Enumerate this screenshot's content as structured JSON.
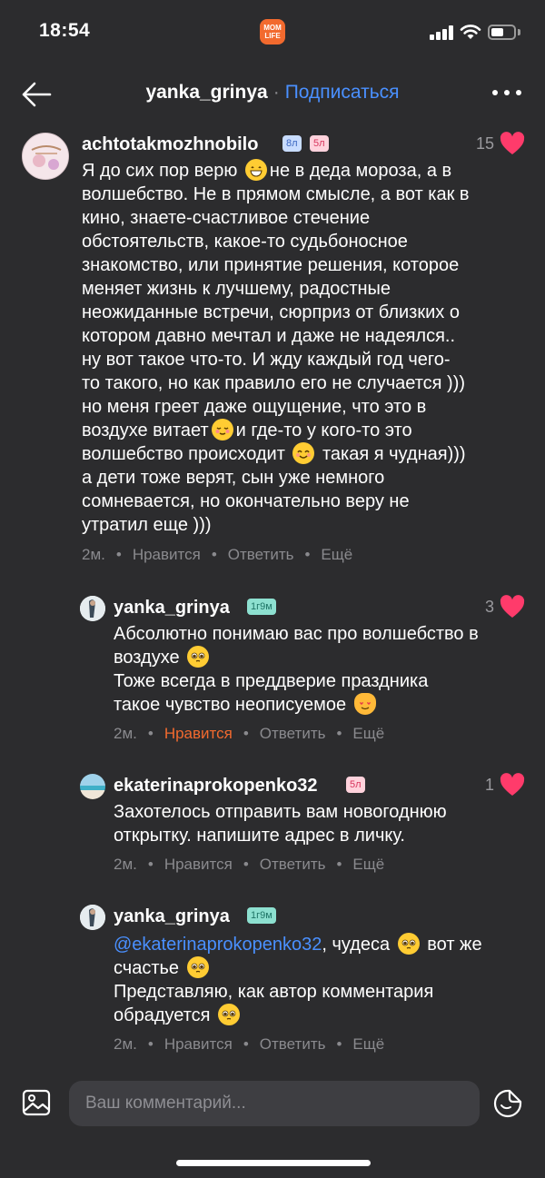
{
  "status_bar": {
    "time": "18:54",
    "app_badge": "MOM LIFE"
  },
  "header": {
    "title": "yanka_grinya",
    "separator": "·",
    "follow_label": "Подписаться"
  },
  "colors": {
    "background": "#2c2c2e",
    "accent_blue": "#4a90ff",
    "heart_pink": "#ff3b6b",
    "liked_orange": "#f26a2e",
    "muted": "#8a8a8e"
  },
  "comments": [
    {
      "username": "achtotakmozhnobilo",
      "badges": [
        "8л",
        "5л"
      ],
      "likes": "15",
      "lines": [
        [
          "Я до сих пор верю ",
          "grin-emoji",
          "не в деда мороза, а в"
        ],
        [
          "волшебство. Не в прямом смысле, а вот как в"
        ],
        [
          "кино, знаете-счастливое стечение"
        ],
        [
          "обстоятельств, какое-то судьбоносное"
        ],
        [
          "знакомство, или принятие решения, которое"
        ],
        [
          "меняет жизнь к лучшему, радостные"
        ],
        [
          "неожиданные встречи, сюрприз от близких о"
        ],
        [
          "котором давно мечтал и даже не надеялся.."
        ],
        [
          "ну вот такое что-то. И жду каждый год чего-"
        ],
        [
          "то такого, но как правило его не случается )))"
        ],
        [
          "но меня греет даже ощущение, что это в"
        ],
        [
          "воздухе витает",
          "blush-emoji",
          "и где-то у кого-то это"
        ],
        [
          "волшебство происходит ",
          "smile-emoji",
          " такая я чудная)))"
        ],
        [
          "а дети тоже верят, сын уже немного"
        ],
        [
          "сомневается, но окончательно веру не"
        ],
        [
          "утратил еще )))"
        ]
      ],
      "time": "2м.",
      "like_label": "Нравится",
      "reply_label": "Ответить",
      "more_label": "Ещё"
    },
    {
      "username": "yanka_grinya",
      "badges": [
        "1г9м"
      ],
      "likes": "3",
      "lines": [
        [
          "Абсолютно понимаю вас про волшебство в"
        ],
        [
          "воздухе ",
          "pleading-emoji"
        ],
        [
          "Тоже всегда в преддверие праздника"
        ],
        [
          "такое чувство неописуемое ",
          "heart-eyes-cat-emoji"
        ]
      ],
      "time": "2м.",
      "like_label": "Нравится",
      "reply_label": "Ответить",
      "more_label": "Ещё"
    },
    {
      "username": "ekaterinaprokopenko32",
      "badges": [
        "5л"
      ],
      "likes": "1",
      "lines": [
        [
          "Захотелось отправить вам новогоднюю"
        ],
        [
          "открытку.  напишите адрес в личку."
        ]
      ],
      "time": "2м.",
      "like_label": "Нравится",
      "reply_label": "Ответить",
      "more_label": "Ещё"
    },
    {
      "username": "yanka_grinya",
      "badges": [
        "1г9м"
      ],
      "likes": "",
      "mention": "@ekaterinaprokopenko32",
      "lines": [
        [
          ", чудеса ",
          "pleading-emoji",
          " вот же"
        ],
        [
          "счастье ",
          "pleading-emoji"
        ],
        [
          "Представляю, как автор комментария"
        ],
        [
          "обрадуется ",
          "pleading-emoji"
        ]
      ],
      "time": "2м.",
      "like_label": "Нравится",
      "reply_label": "Ответить",
      "more_label": "Ещё"
    }
  ],
  "composer": {
    "placeholder": "Ваш комментарий..."
  }
}
